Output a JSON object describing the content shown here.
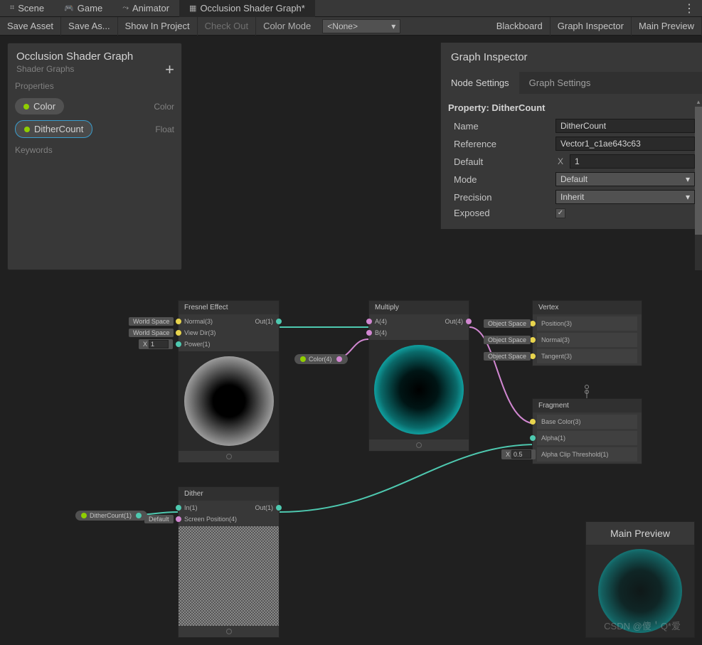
{
  "tabs": {
    "scene": "Scene",
    "game": "Game",
    "animator": "Animator",
    "graph": "Occlusion Shader Graph*"
  },
  "toolbar": {
    "save": "Save Asset",
    "saveas": "Save As...",
    "show": "Show In Project",
    "checkout": "Check Out",
    "colormode": "Color Mode",
    "colorsel": "<None>",
    "blackboard": "Blackboard",
    "inspector": "Graph Inspector",
    "preview": "Main Preview"
  },
  "blackboard": {
    "title": "Occlusion Shader Graph",
    "subtitle": "Shader Graphs",
    "sec_props": "Properties",
    "sec_keys": "Keywords",
    "props": [
      {
        "name": "Color",
        "type": "Color"
      },
      {
        "name": "DitherCount",
        "type": "Float"
      }
    ]
  },
  "inspector": {
    "title": "Graph Inspector",
    "tab_node": "Node Settings",
    "tab_graph": "Graph Settings",
    "prop_header": "Property: DitherCount",
    "rows": {
      "name_l": "Name",
      "name_v": "DitherCount",
      "ref_l": "Reference",
      "ref_v": "Vector1_c1ae643c63",
      "def_l": "Default",
      "def_x": "X",
      "def_v": "1",
      "mode_l": "Mode",
      "mode_v": "Default",
      "prec_l": "Precision",
      "prec_v": "Inherit",
      "exp_l": "Exposed",
      "exp_v": "✓"
    }
  },
  "nodes": {
    "fresnel": {
      "title": "Fresnel Effect",
      "normal": "Normal(3)",
      "viewdir": "View Dir(3)",
      "power": "Power(1)",
      "out": "Out(1)",
      "ws": "World Space",
      "x": "X",
      "xval": "1"
    },
    "multiply": {
      "title": "Multiply",
      "a": "A(4)",
      "b": "B(4)",
      "out": "Out(4)"
    },
    "vertex": {
      "title": "Vertex",
      "os": "Object Space",
      "pos": "Position(3)",
      "norm": "Normal(3)",
      "tan": "Tangent(3)"
    },
    "fragment": {
      "title": "Fragment",
      "base": "Base Color(3)",
      "alpha": "Alpha(1)",
      "clip": "Alpha Clip Threshold(1)",
      "x": "X",
      "xval": "0.5"
    },
    "dither": {
      "title": "Dither",
      "in": "In(1)",
      "sp": "Screen Position(4)",
      "out": "Out(1)",
      "def": "Default"
    },
    "colorpill": "Color(4)",
    "ditherpill": "DitherCount(1)"
  },
  "mainpreview": {
    "title": "Main Preview"
  },
  "watermark": "CSDN @傻＇Q*爱"
}
